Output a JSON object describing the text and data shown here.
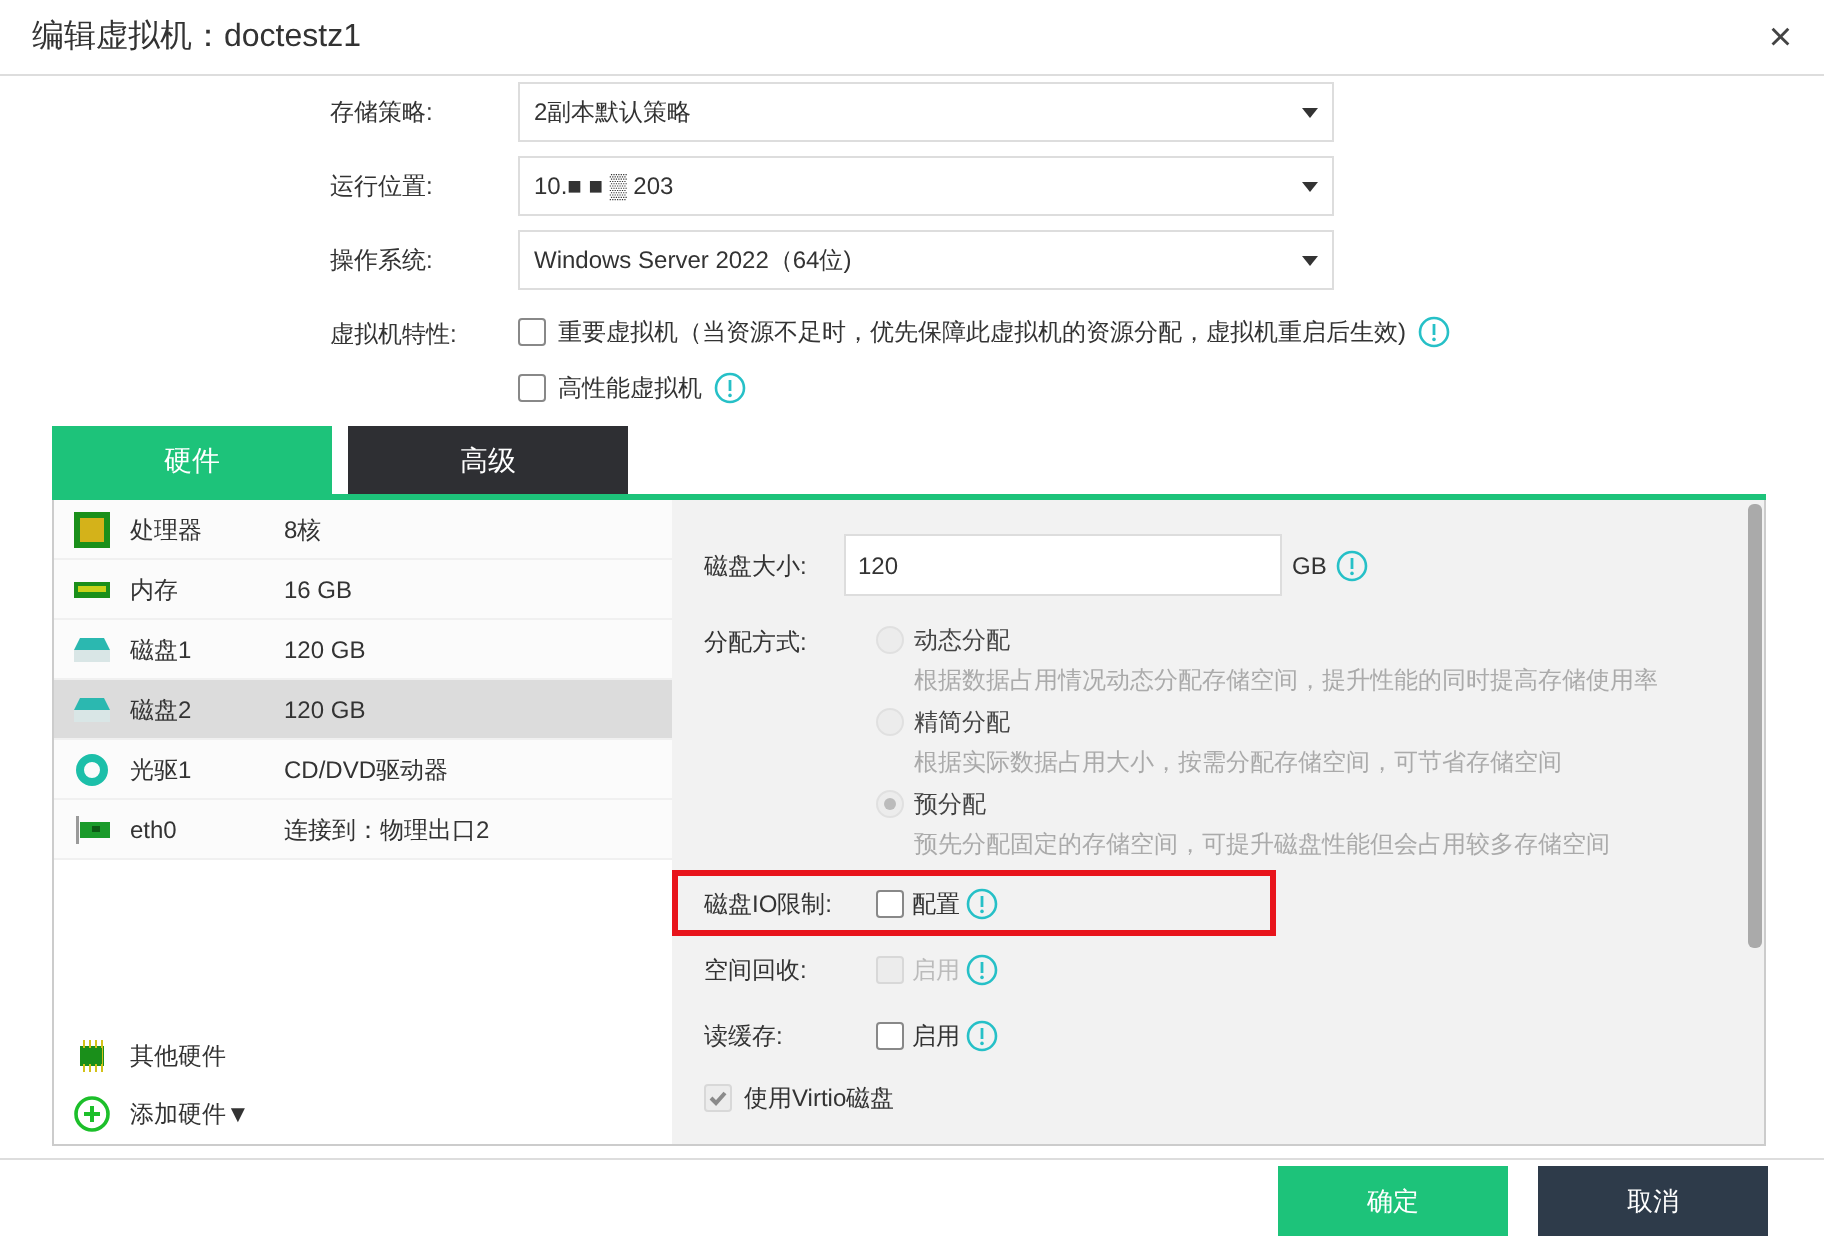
{
  "window": {
    "title": "编辑虚拟机：doctestz1",
    "close": "×"
  },
  "form": [
    {
      "label": "存储策略:",
      "value": "2副本默认策略"
    },
    {
      "label": "运行位置:",
      "value": "10.■ ■ ▒ 203"
    },
    {
      "label": "操作系统:",
      "value": "Windows Server 2022（64位)"
    }
  ],
  "features": {
    "label": "虚拟机特性:",
    "options": [
      {
        "label": "重要虚拟机（当资源不足时，优先保障此虚拟机的资源分配，虚拟机重启后生效)",
        "checked": false
      },
      {
        "label": "高性能虚拟机",
        "checked": false
      }
    ]
  },
  "tabs": [
    {
      "label": "硬件",
      "selected": true
    },
    {
      "label": "高级",
      "selected": false
    }
  ],
  "hardware": [
    {
      "kind": "cpu",
      "name": "处理器",
      "value": "8核",
      "selected": false
    },
    {
      "kind": "memory",
      "name": "内存",
      "value": "16 GB",
      "selected": false
    },
    {
      "kind": "disk",
      "name": "磁盘1",
      "value": "120 GB",
      "selected": false
    },
    {
      "kind": "disk",
      "name": "磁盘2",
      "value": "120 GB",
      "selected": true
    },
    {
      "kind": "cdrom",
      "name": "光驱1",
      "value": "CD/DVD驱动器",
      "selected": false
    },
    {
      "kind": "nic",
      "name": "eth0",
      "value": "连接到：物理出口2",
      "selected": false
    }
  ],
  "other_hardware": "其他硬件",
  "add_hardware": "添加硬件▼",
  "disk": {
    "size_label": "磁盘大小:",
    "size": "120",
    "unit": "GB",
    "alloc_label": "分配方式:",
    "alloc": [
      {
        "label": "动态分配",
        "desc": "根据数据占用情况动态分配存储空间，提升性能的同时提高存储使用率",
        "selected": false,
        "disabled": true
      },
      {
        "label": "精简分配",
        "desc": "根据实际数据占用大小，按需分配存储空间，可节省存储空间",
        "selected": false,
        "disabled": true
      },
      {
        "label": "预分配",
        "desc": "预先分配固定的存储空间，可提升磁盘性能但会占用较多存储空间",
        "selected": true,
        "disabled": true
      }
    ],
    "options": [
      {
        "label": "磁盘IO限制:",
        "option": "配置",
        "checked": false,
        "disabled": false,
        "highlighted": true
      },
      {
        "label": "空间回收:",
        "option": "启用",
        "checked": false,
        "disabled": true,
        "highlighted": false
      },
      {
        "label": "读缓存:",
        "option": "启用",
        "checked": false,
        "disabled": false,
        "highlighted": false
      }
    ],
    "virtio": {
      "label": "使用Virtio磁盘",
      "checked": true,
      "disabled": true
    }
  },
  "buttons": [
    {
      "kind": "primary",
      "label": "确定"
    },
    {
      "kind": "secondary",
      "label": "取消"
    }
  ]
}
